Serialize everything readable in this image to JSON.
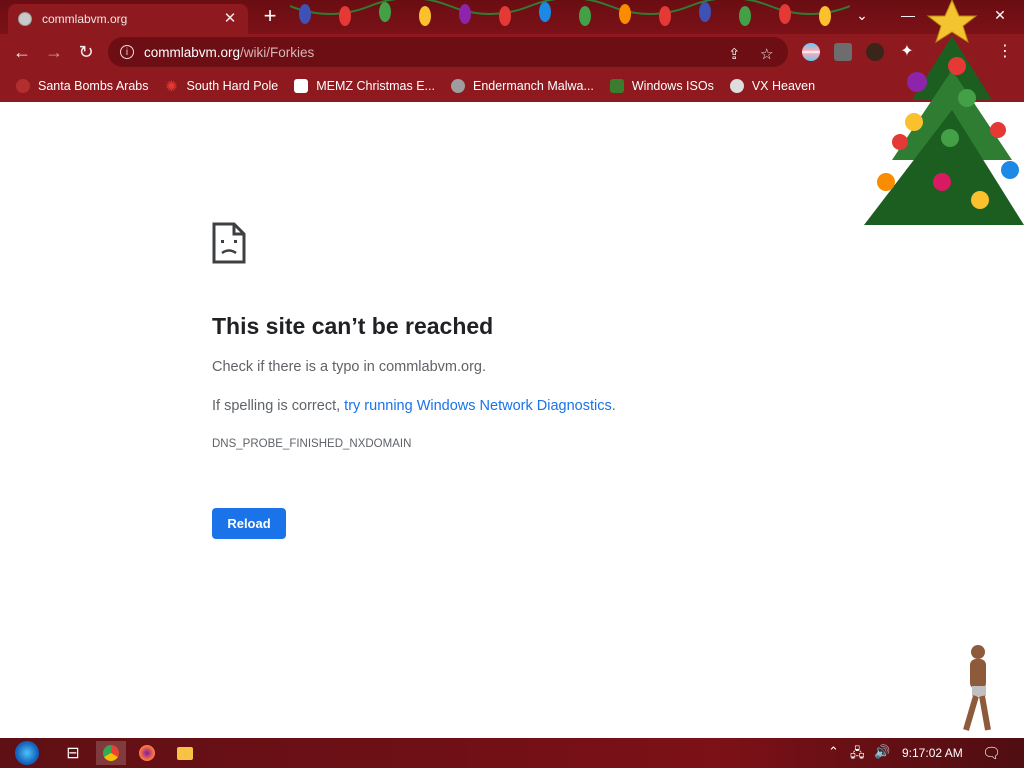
{
  "tab": {
    "title": "commlabvm.org",
    "close": "✕"
  },
  "toolbar": {
    "url_host": "commlabvm.org",
    "url_path": "/wiki/Forkies"
  },
  "bookmarks": [
    {
      "label": "Santa Bombs Arabs",
      "icon": "santa-icon",
      "color": "#b32e2e"
    },
    {
      "label": "South Hard Pole",
      "icon": "snowflake-icon",
      "color": "#d32f2f"
    },
    {
      "label": "MEMZ Christmas E...",
      "icon": "memz-icon",
      "color": "#ffffff"
    },
    {
      "label": "Endermanch Malwa...",
      "icon": "endermanch-icon",
      "color": "#9e9e9e"
    },
    {
      "label": "Windows ISOs",
      "icon": "windows-icon",
      "color": "#3b7d2e"
    },
    {
      "label": "VX Heaven",
      "icon": "vx-icon",
      "color": "#dddddd"
    }
  ],
  "error": {
    "title": "This site can’t be reached",
    "line1": "Check if there is a typo in commlabvm.org.",
    "line2_prefix": "If spelling is correct, ",
    "line2_link": "try running Windows Network Diagnostics",
    "line2_suffix": ".",
    "code": "DNS_PROBE_FINISHED_NXDOMAIN",
    "reload_label": "Reload"
  },
  "taskbar": {
    "time": "9:17:02 AM"
  },
  "colors": {
    "chrome_dark": "#6a0d12",
    "chrome": "#8e1a1f",
    "link": "#1a73e8",
    "button": "#1a73e8"
  }
}
